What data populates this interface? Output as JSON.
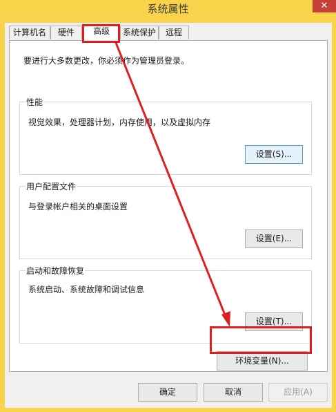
{
  "window": {
    "title": "系统属性",
    "close_glyph": "✕"
  },
  "tabs": [
    {
      "label": "计算机名"
    },
    {
      "label": "硬件"
    },
    {
      "label": "高级",
      "active": true
    },
    {
      "label": "系统保护"
    },
    {
      "label": "远程"
    }
  ],
  "advanced": {
    "intro": "要进行大多数更改，你必须作为管理员登录。",
    "performance": {
      "title": "性能",
      "description": "视觉效果，处理器计划，内存使用，以及虚拟内存",
      "button": "设置(S)..."
    },
    "user_profiles": {
      "title": "用户配置文件",
      "description": "与登录帐户相关的桌面设置",
      "button": "设置(E)..."
    },
    "startup_recovery": {
      "title": "启动和故障恢复",
      "description": "系统启动、系统故障和调试信息",
      "button": "设置(T)..."
    },
    "env_button": "环境变量(N)..."
  },
  "footer": {
    "ok": "确定",
    "cancel": "取消",
    "apply": "应用(A)"
  },
  "annotation_color": "#e01e1e"
}
